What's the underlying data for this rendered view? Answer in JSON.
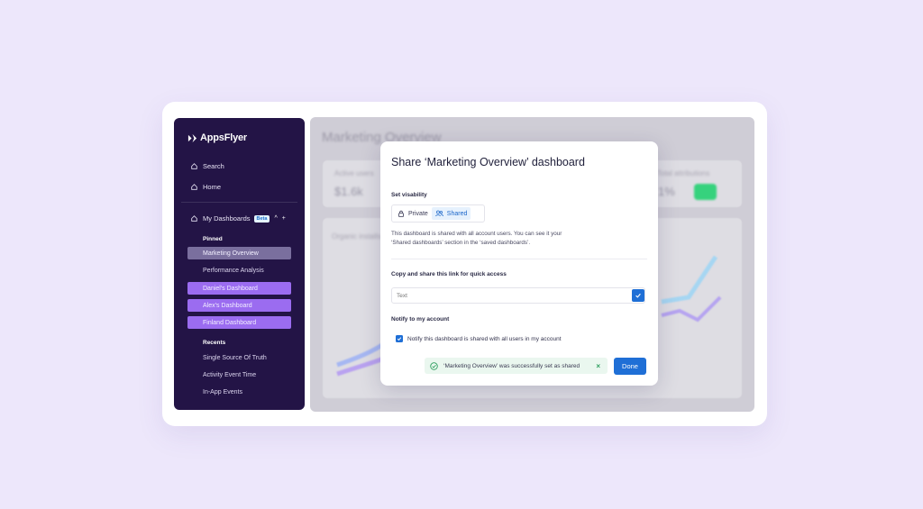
{
  "sidebar": {
    "brand": "AppsFlyer",
    "search_label": "Search",
    "home_label": "Home",
    "my_dashboards_label": "My Dashboards",
    "beta_badge": "Beta",
    "collapse_glyph": "^",
    "add_glyph": "+",
    "pinned_label": "Pinned",
    "pinned": [
      {
        "label": "Marketing Overview"
      },
      {
        "label": "Performance Analysis"
      },
      {
        "label": "Daniel's Dashboard"
      },
      {
        "label": "Alex's Dashboard"
      },
      {
        "label": "Finland Dashboard"
      }
    ],
    "recents_label": "Recents",
    "recents": [
      {
        "label": "Single Source Of Truth"
      },
      {
        "label": "Activity Event Time"
      },
      {
        "label": "In-App Events"
      }
    ]
  },
  "background": {
    "title": "Marketing Overview",
    "kpi_1_label": "Active users",
    "kpi_1_value": "$1.6k",
    "kpi_2_label": "Total attributions",
    "kpi_2_value": "1%",
    "chart_label": "Organic installs"
  },
  "modal": {
    "title": "Share ‘Marketing Overview’ dashboard",
    "visibility_label": "Set visability",
    "private_label": "Private",
    "shared_label": "Shared",
    "description": "This dashboard is shared with all account users. You can see it your ‘Shared dashboards’ section in the ‘saved dashboards’.",
    "link_label": "Copy and share this link for quick access",
    "link_placeholder": "Text",
    "notify_label": "Notify to my account",
    "notify_checkbox_label": "Notify this dashboard is shared with all users in my account",
    "toast_message": "‘Marketing Overview’ was successfully set as shared",
    "toast_close": "×",
    "done_label": "Done"
  },
  "colors": {
    "sidebar_bg": "#231446",
    "accent_purple": "#9b6cf0",
    "primary_blue": "#1f6fd6",
    "success_green": "#36d27d"
  }
}
